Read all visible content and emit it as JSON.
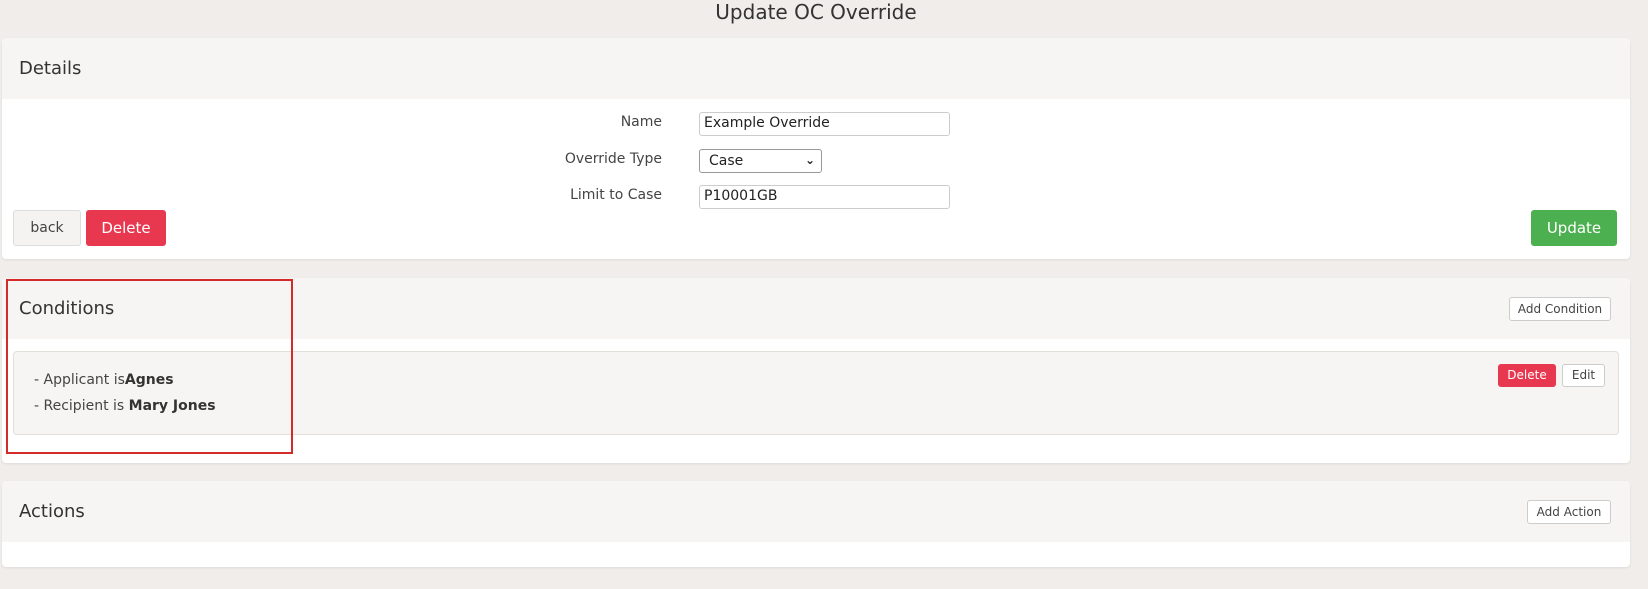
{
  "page": {
    "title": "Update OC Override"
  },
  "details": {
    "heading": "Details",
    "fields": {
      "name_label": "Name",
      "name_value": "Example Override",
      "type_label": "Override Type",
      "type_value": "Case",
      "limit_label": "Limit to Case",
      "limit_value": "P10001GB"
    },
    "back_label": "back",
    "delete_label": "Delete",
    "update_label": "Update"
  },
  "conditions": {
    "heading": "Conditions",
    "add_label": "Add Condition",
    "items": [
      {
        "prefix": "- Applicant is",
        "value": "Agnes"
      },
      {
        "prefix": "- Recipient is ",
        "value": "Mary Jones"
      }
    ],
    "delete_label": "Delete",
    "edit_label": "Edit"
  },
  "actions": {
    "heading": "Actions",
    "add_label": "Add Action"
  },
  "colors": {
    "danger": "#e8384f",
    "success": "#4caf50",
    "highlight": "#d42a2a"
  }
}
